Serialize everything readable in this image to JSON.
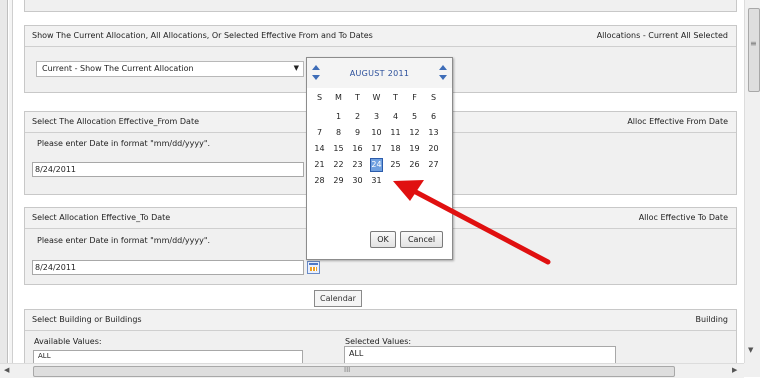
{
  "sections": {
    "allocation": {
      "title": "Show The Current Allocation, All Allocations, Or Selected Effective From and To Dates",
      "right": "Allocations - Current All Selected",
      "selected": "Current - Show The Current Allocation"
    },
    "from_date": {
      "title": "Select The Allocation Effective_From Date",
      "right": "Alloc Effective From Date",
      "hint": "Please enter Date in format \"mm/dd/yyyy\".",
      "value": "8/24/2011"
    },
    "to_date": {
      "title": "Select Allocation Effective_To Date",
      "right": "Alloc Effective To Date",
      "hint": "Please enter Date in format \"mm/dd/yyyy\".",
      "value": "8/24/2011"
    },
    "building": {
      "title": "Select Building or Buildings",
      "right": "Building",
      "available_label": "Available Values:",
      "available_first": "ALL",
      "selected_label": "Selected Values:",
      "selected_first": "ALL"
    }
  },
  "tooltip": "Calendar",
  "calendar": {
    "month": "AUGUST 2011",
    "dow": [
      "S",
      "M",
      "T",
      "W",
      "T",
      "F",
      "S"
    ],
    "weeks": [
      [
        "",
        "1",
        "2",
        "3",
        "4",
        "5",
        "6"
      ],
      [
        "7",
        "8",
        "9",
        "10",
        "11",
        "12",
        "13"
      ],
      [
        "14",
        "15",
        "16",
        "17",
        "18",
        "19",
        "20"
      ],
      [
        "21",
        "22",
        "23",
        "24",
        "25",
        "26",
        "27"
      ],
      [
        "28",
        "29",
        "30",
        "31",
        "",
        "",
        ""
      ]
    ],
    "selected_day": "24",
    "ok_label": "OK",
    "cancel_label": "Cancel"
  },
  "annotation_color": "#e01010",
  "icons": {
    "dropdown": "chevron-down-icon",
    "calendar": "calendar-icon"
  },
  "scroll": {
    "vertical_mark": "≡",
    "horizontal_mark": "III"
  }
}
